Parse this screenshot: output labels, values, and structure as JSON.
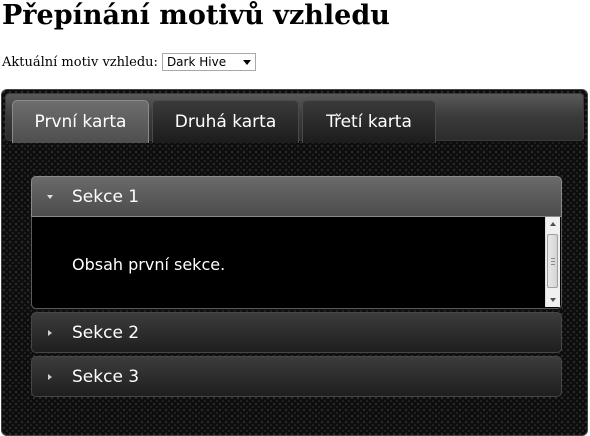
{
  "page": {
    "title": "Přepínání motivů vzhledu"
  },
  "theme_switcher": {
    "label": "Aktuální motiv vzhledu:",
    "selected": "Dark Hive"
  },
  "tabs": [
    {
      "label": "První karta",
      "active": true
    },
    {
      "label": "Druhá karta",
      "active": false
    },
    {
      "label": "Třetí karta",
      "active": false
    }
  ],
  "accordion": {
    "sections": [
      {
        "title": "Sekce 1",
        "open": true,
        "content": "Obsah první sekce."
      },
      {
        "title": "Sekce 2",
        "open": false
      },
      {
        "title": "Sekce 3",
        "open": false
      }
    ]
  },
  "icons": {
    "open": "triangle-down-icon",
    "closed": "triangle-right-icon"
  },
  "colors": {
    "widget_background": "#0c0c0c",
    "header_active": "#5a5a5a",
    "text": "#ffffff"
  }
}
